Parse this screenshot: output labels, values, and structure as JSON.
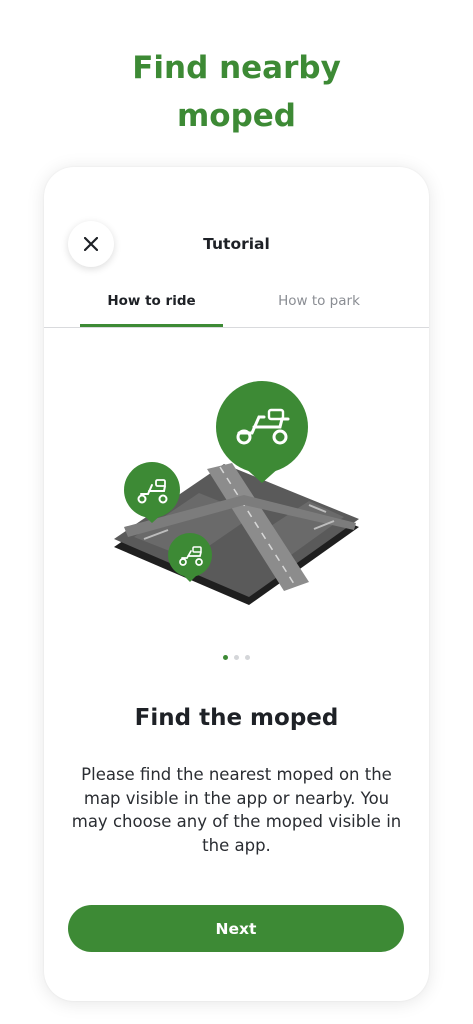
{
  "headline": {
    "line1": "Find nearby",
    "line2": "moped"
  },
  "sheet": {
    "title": "Tutorial",
    "close_icon": "close-icon",
    "tabs": [
      {
        "label": "How to ride",
        "active": true
      },
      {
        "label": "How to park",
        "active": false
      }
    ]
  },
  "illustration": {
    "description_icon": "map-with-moped-pins-icon",
    "pin_color": "#3d8a35"
  },
  "carousel": {
    "page_count": 3,
    "active_index": 0
  },
  "card": {
    "title": "Find the moped",
    "body": "Please find the nearest moped on the map visible in the app or nearby. You may choose any of the moped visible in the app."
  },
  "actions": {
    "next_label": "Next"
  },
  "colors": {
    "accent": "#3d8a35",
    "text_primary": "#1e2126",
    "text_muted": "#8a8d93"
  }
}
